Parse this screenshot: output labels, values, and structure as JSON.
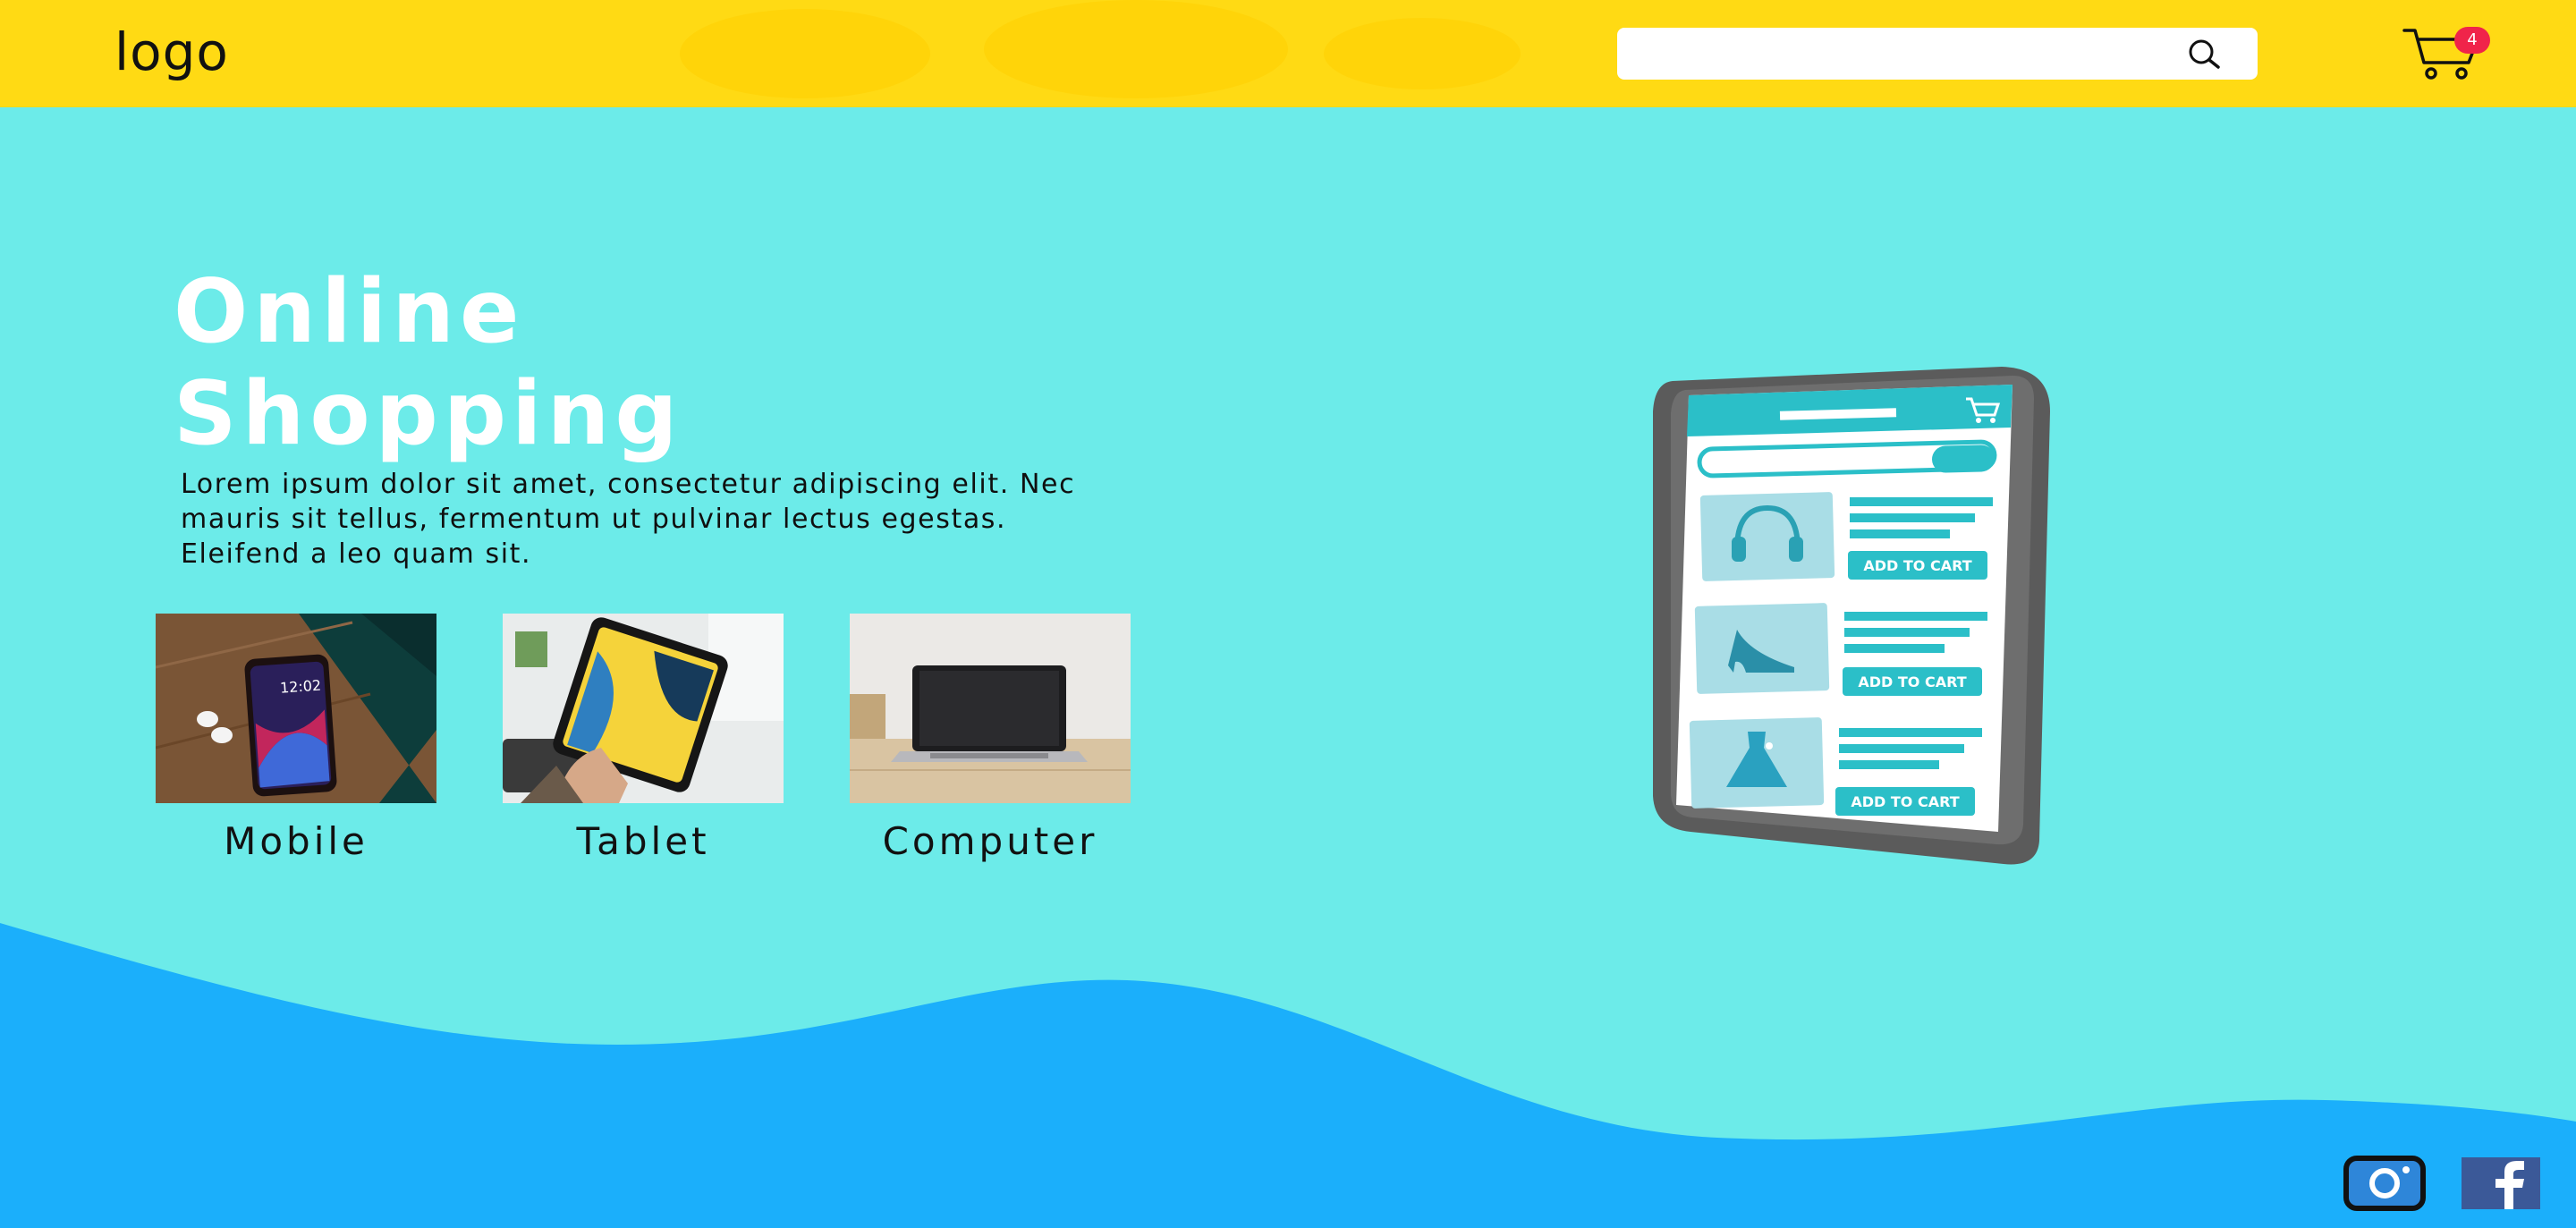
{
  "header": {
    "logo_text": "logo",
    "search": {
      "placeholder": "",
      "value": ""
    },
    "cart_count": "4"
  },
  "hero": {
    "title_line1": "Online",
    "title_line2": "Shopping",
    "description": "Lorem ipsum dolor sit amet, consectetur adipiscing elit. Nec mauris sit tellus, fermentum ut pulvinar lectus egestas. Eleifend a leo quam sit."
  },
  "categories": [
    {
      "label": "Mobile",
      "icon": "smartphone-photo"
    },
    {
      "label": "Tablet",
      "icon": "tablet-photo"
    },
    {
      "label": "Computer",
      "icon": "laptop-photo"
    }
  ],
  "illustration": {
    "button_label": "ADD TO CART",
    "product_icons": [
      "headphones-icon",
      "high-heel-icon",
      "dress-icon"
    ]
  },
  "social": [
    {
      "name": "instagram-icon"
    },
    {
      "name": "facebook-icon"
    }
  ],
  "colors": {
    "header": "#FFDA14",
    "hero_bg": "#6CEBE9",
    "wave": "#1BAFFB",
    "badge": "#F0244A",
    "phone_accent": "#2BBFC8"
  }
}
